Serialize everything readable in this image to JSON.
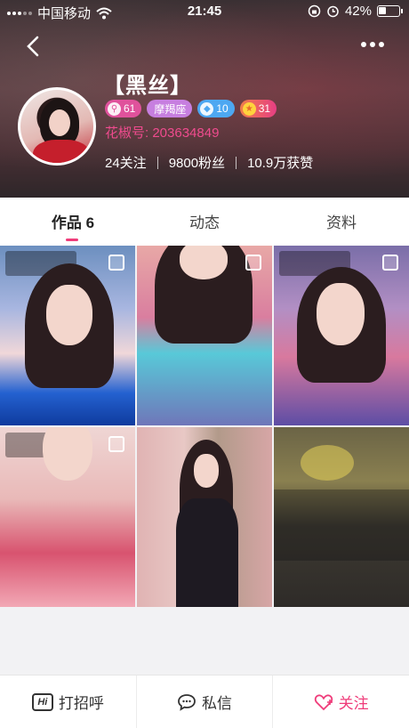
{
  "status_bar": {
    "carrier": "中国移动",
    "time": "21:45",
    "battery": "42%",
    "battery_level": 0.42
  },
  "profile": {
    "nickname": "【黑丝】",
    "badges": {
      "level": "61",
      "zodiac": "摩羯座",
      "diamond": "10",
      "star": "31"
    },
    "huajiao_id_label": "花椒号:",
    "huajiao_id": "203634849",
    "stats": {
      "following": "24关注",
      "fans": "9800粉丝",
      "likes": "10.9万获赞"
    }
  },
  "tabs": [
    {
      "label": "作品 6"
    },
    {
      "label": "动态"
    },
    {
      "label": "资料"
    }
  ],
  "works_count": 6,
  "bottom_bar": {
    "greet_label": "打招呼",
    "greet_icon_text": "Hi",
    "message_label": "私信",
    "follow_label": "关注"
  },
  "colors": {
    "accent": "#ef3c7a",
    "id_color": "#ef4b8e"
  },
  "icons": [
    "back-arrow-icon",
    "more-dots-icon",
    "wifi-icon",
    "alarm-icon",
    "lock-rotation-icon",
    "battery-icon",
    "chat-bubble-icon",
    "heart-icon"
  ]
}
